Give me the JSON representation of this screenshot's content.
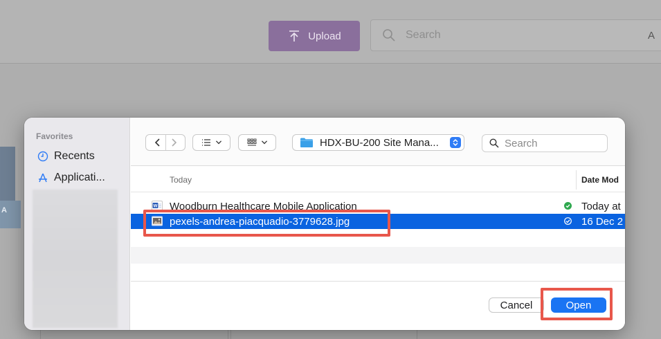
{
  "background": {
    "upload_label": "Upload",
    "search_placeholder": "Search",
    "search_tail": "A",
    "card_letter": "A"
  },
  "sidebar": {
    "title": "Favorites",
    "items": [
      {
        "label": "Recents",
        "icon": "clock-icon"
      },
      {
        "label": "Applicati...",
        "icon": "applications-icon"
      }
    ]
  },
  "toolbar": {
    "folder_name": "HDX-BU-200 Site Mana...",
    "search_placeholder": "Search"
  },
  "list": {
    "group_label": "Today",
    "date_column": "Date Mod",
    "files": [
      {
        "name": "Woodburn Healthcare Mobile Application",
        "date": "Today at",
        "icon": "word-doc-icon",
        "selected": false,
        "status_color": "#2fa84f"
      },
      {
        "name": "pexels-andrea-piacquadio-3779628.jpg",
        "date": "16 Dec 2",
        "icon": "image-file-icon",
        "selected": true,
        "status_color": "#ffffff"
      }
    ]
  },
  "footer": {
    "cancel_label": "Cancel",
    "open_label": "Open"
  },
  "colors": {
    "accent": "#1a74f3",
    "selection": "#0a63e0",
    "highlight": "#e8574b",
    "upload_button": "#8a6f9c"
  }
}
